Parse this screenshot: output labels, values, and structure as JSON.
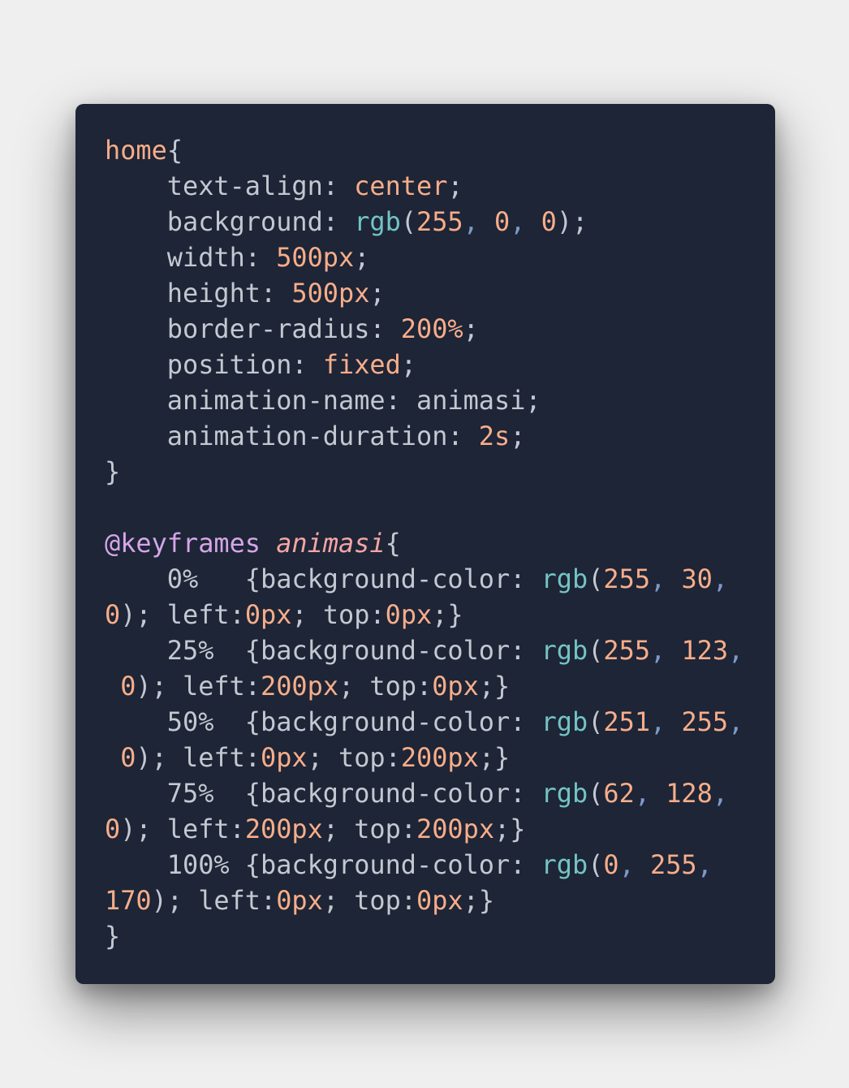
{
  "code": {
    "lines": [
      [
        {
          "t": "home",
          "c": "sel"
        },
        {
          "t": "{",
          "c": "plain"
        }
      ],
      [
        {
          "t": "    text-align: ",
          "c": "plain"
        },
        {
          "t": "center",
          "c": "num"
        },
        {
          "t": ";",
          "c": "plain"
        }
      ],
      [
        {
          "t": "    background: ",
          "c": "plain"
        },
        {
          "t": "rgb",
          "c": "fn"
        },
        {
          "t": "(",
          "c": "plain"
        },
        {
          "t": "255",
          "c": "num"
        },
        {
          "t": ", ",
          "c": "comma"
        },
        {
          "t": "0",
          "c": "num"
        },
        {
          "t": ", ",
          "c": "comma"
        },
        {
          "t": "0",
          "c": "num"
        },
        {
          "t": ");",
          "c": "plain"
        }
      ],
      [
        {
          "t": "    width: ",
          "c": "plain"
        },
        {
          "t": "500px",
          "c": "num"
        },
        {
          "t": ";",
          "c": "plain"
        }
      ],
      [
        {
          "t": "    height: ",
          "c": "plain"
        },
        {
          "t": "500px",
          "c": "num"
        },
        {
          "t": ";",
          "c": "plain"
        }
      ],
      [
        {
          "t": "    border-radius: ",
          "c": "plain"
        },
        {
          "t": "200%",
          "c": "num"
        },
        {
          "t": ";",
          "c": "plain"
        }
      ],
      [
        {
          "t": "    position: ",
          "c": "plain"
        },
        {
          "t": "fixed",
          "c": "num"
        },
        {
          "t": ";",
          "c": "plain"
        }
      ],
      [
        {
          "t": "    animation-name: animasi;",
          "c": "plain"
        }
      ],
      [
        {
          "t": "    animation-duration: ",
          "c": "plain"
        },
        {
          "t": "2s",
          "c": "num"
        },
        {
          "t": ";",
          "c": "plain"
        }
      ],
      [
        {
          "t": "}",
          "c": "plain"
        }
      ],
      [],
      [
        {
          "t": "@keyframes ",
          "c": "at"
        },
        {
          "t": "animasi",
          "c": "anim"
        },
        {
          "t": "{",
          "c": "plain"
        }
      ],
      [
        {
          "t": "    0%   {background-color: ",
          "c": "plain"
        },
        {
          "t": "rgb",
          "c": "fn"
        },
        {
          "t": "(",
          "c": "plain"
        },
        {
          "t": "255",
          "c": "num"
        },
        {
          "t": ", ",
          "c": "comma"
        },
        {
          "t": "30",
          "c": "num"
        },
        {
          "t": ",",
          "c": "comma"
        }
      ],
      [
        {
          "t": "0",
          "c": "num"
        },
        {
          "t": "); left:",
          "c": "plain"
        },
        {
          "t": "0px",
          "c": "num"
        },
        {
          "t": "; top:",
          "c": "plain"
        },
        {
          "t": "0px",
          "c": "num"
        },
        {
          "t": ";}",
          "c": "plain"
        }
      ],
      [
        {
          "t": "    25%  {background-color: ",
          "c": "plain"
        },
        {
          "t": "rgb",
          "c": "fn"
        },
        {
          "t": "(",
          "c": "plain"
        },
        {
          "t": "255",
          "c": "num"
        },
        {
          "t": ", ",
          "c": "comma"
        },
        {
          "t": "123",
          "c": "num"
        },
        {
          "t": ",",
          "c": "comma"
        }
      ],
      [
        {
          "t": " ",
          "c": "plain"
        },
        {
          "t": "0",
          "c": "num"
        },
        {
          "t": "); left:",
          "c": "plain"
        },
        {
          "t": "200px",
          "c": "num"
        },
        {
          "t": "; top:",
          "c": "plain"
        },
        {
          "t": "0px",
          "c": "num"
        },
        {
          "t": ";}",
          "c": "plain"
        }
      ],
      [
        {
          "t": "    50%  {background-color: ",
          "c": "plain"
        },
        {
          "t": "rgb",
          "c": "fn"
        },
        {
          "t": "(",
          "c": "plain"
        },
        {
          "t": "251",
          "c": "num"
        },
        {
          "t": ", ",
          "c": "comma"
        },
        {
          "t": "255",
          "c": "num"
        },
        {
          "t": ",",
          "c": "comma"
        }
      ],
      [
        {
          "t": " ",
          "c": "plain"
        },
        {
          "t": "0",
          "c": "num"
        },
        {
          "t": "); left:",
          "c": "plain"
        },
        {
          "t": "0px",
          "c": "num"
        },
        {
          "t": "; top:",
          "c": "plain"
        },
        {
          "t": "200px",
          "c": "num"
        },
        {
          "t": ";}",
          "c": "plain"
        }
      ],
      [
        {
          "t": "    75%  {background-color: ",
          "c": "plain"
        },
        {
          "t": "rgb",
          "c": "fn"
        },
        {
          "t": "(",
          "c": "plain"
        },
        {
          "t": "62",
          "c": "num"
        },
        {
          "t": ", ",
          "c": "comma"
        },
        {
          "t": "128",
          "c": "num"
        },
        {
          "t": ",",
          "c": "comma"
        }
      ],
      [
        {
          "t": "0",
          "c": "num"
        },
        {
          "t": "); left:",
          "c": "plain"
        },
        {
          "t": "200px",
          "c": "num"
        },
        {
          "t": "; top:",
          "c": "plain"
        },
        {
          "t": "200px",
          "c": "num"
        },
        {
          "t": ";}",
          "c": "plain"
        }
      ],
      [
        {
          "t": "    100% {background-color: ",
          "c": "plain"
        },
        {
          "t": "rgb",
          "c": "fn"
        },
        {
          "t": "(",
          "c": "plain"
        },
        {
          "t": "0",
          "c": "num"
        },
        {
          "t": ", ",
          "c": "comma"
        },
        {
          "t": "255",
          "c": "num"
        },
        {
          "t": ",",
          "c": "comma"
        }
      ],
      [
        {
          "t": "170",
          "c": "num"
        },
        {
          "t": "); left:",
          "c": "plain"
        },
        {
          "t": "0px",
          "c": "num"
        },
        {
          "t": "; top:",
          "c": "plain"
        },
        {
          "t": "0px",
          "c": "num"
        },
        {
          "t": ";}",
          "c": "plain"
        }
      ],
      [
        {
          "t": "}",
          "c": "plain"
        }
      ]
    ]
  },
  "colors": {
    "page_background": "#efefef",
    "card_background": "#1d2536",
    "text": "#c3c8d1",
    "number": "#f8ad8a",
    "function": "#74c3c6",
    "comma": "#7f99c9",
    "at_rule": "#d6a5e8",
    "animation_name": "#f4a5a5"
  }
}
